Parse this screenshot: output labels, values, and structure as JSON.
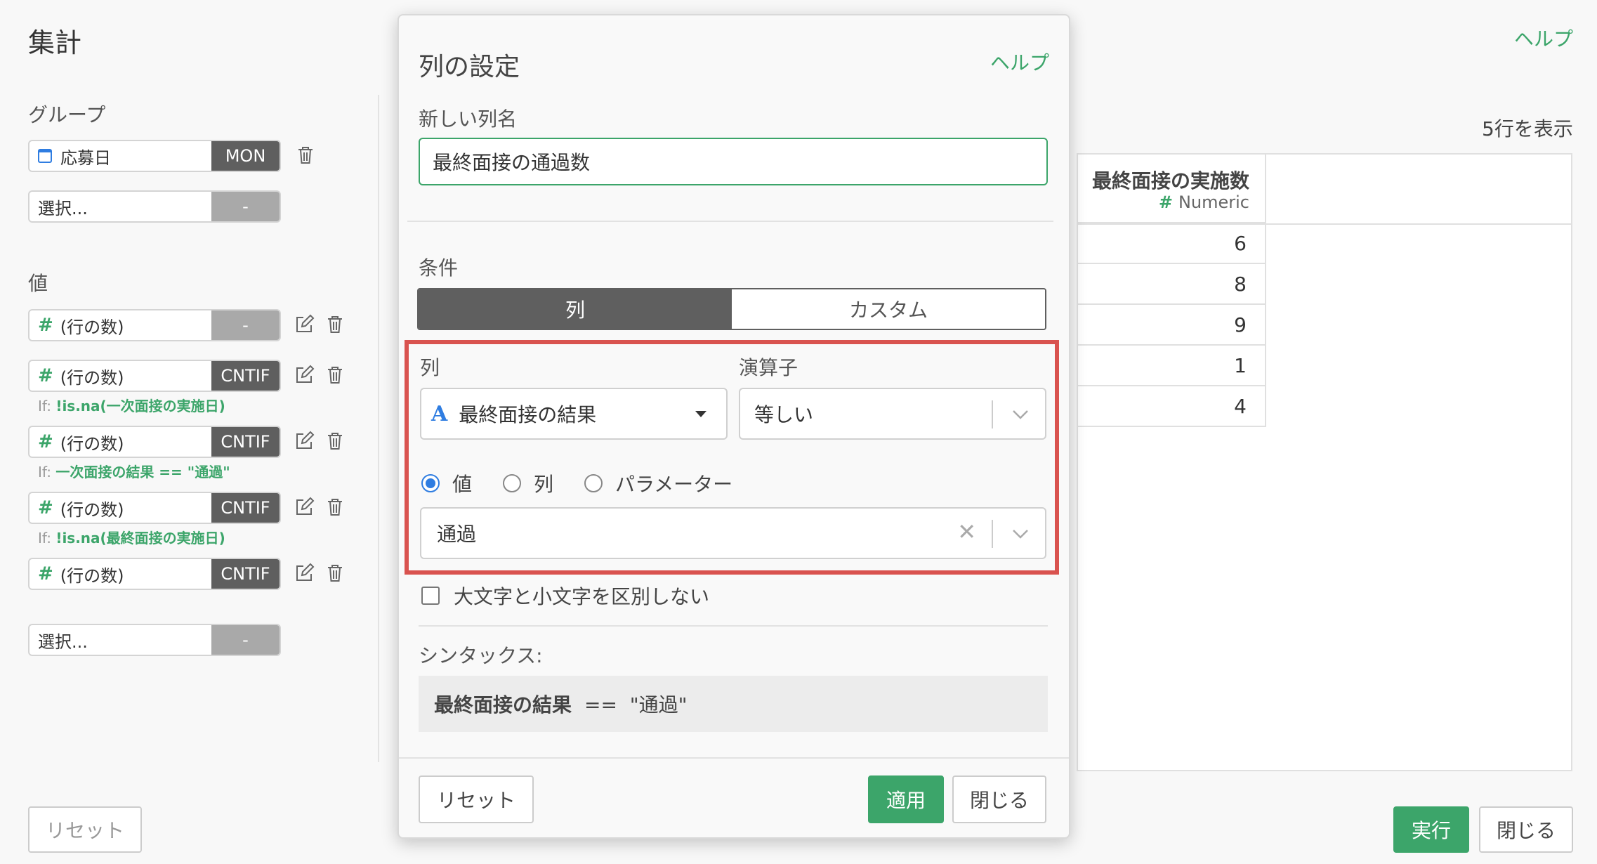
{
  "panel": {
    "title": "集計",
    "help": "ヘルプ",
    "group_heading": "グループ",
    "group_rows": [
      {
        "label": "応募日",
        "tag": "MON"
      },
      {
        "label": "選択...",
        "tag": "-"
      }
    ],
    "value_heading": "値",
    "value_rows": [
      {
        "label": "(行の数)",
        "tag": "-",
        "cond_prefix": "",
        "cond": ""
      },
      {
        "label": "(行の数)",
        "tag": "CNTIF",
        "cond_prefix": "If:",
        "cond": "!is.na(一次面接の実施日)"
      },
      {
        "label": "(行の数)",
        "tag": "CNTIF",
        "cond_prefix": "If:",
        "cond": "一次面接の結果 == \"通過\""
      },
      {
        "label": "(行の数)",
        "tag": "CNTIF",
        "cond_prefix": "If:",
        "cond": "!is.na(最終面接の実施日)"
      },
      {
        "label": "(行の数)",
        "tag": "CNTIF",
        "cond_prefix": "",
        "cond": ""
      }
    ],
    "value_select": {
      "label": "選択...",
      "tag": "-"
    },
    "reset": "リセット",
    "run": "実行",
    "close": "閉じる"
  },
  "table": {
    "row_count": "5行を表示",
    "column": {
      "name": "最終面接の実施数",
      "type_icon": "#",
      "type": "Numeric"
    },
    "values": [
      "6",
      "8",
      "9",
      "1",
      "4"
    ]
  },
  "dialog": {
    "title": "列の設定",
    "help": "ヘルプ",
    "new_name_label": "新しい列名",
    "new_name_value": "最終面接の通過数",
    "condition_label": "条件",
    "tabs": [
      "列",
      "カスタム"
    ],
    "column_label": "列",
    "column_value": "最終面接の結果",
    "column_type_icon": "A",
    "operator_label": "演算子",
    "operator_value": "等しい",
    "radios": [
      "値",
      "列",
      "パラメーター"
    ],
    "selected_radio": "値",
    "value_input": "通過",
    "ignore_case": "大文字と小文字を区別しない",
    "syntax_label": "シンタックス:",
    "syntax_column": "最終面接の結果",
    "syntax_rest": "==  \"通過\"",
    "reset": "リセット",
    "apply": "適用",
    "close": "閉じる"
  },
  "colors": {
    "accent_green": "#3ca56a",
    "highlight_red": "#d9534f",
    "dark_tag": "#5f5f5f",
    "radio_blue": "#2f7de1"
  }
}
